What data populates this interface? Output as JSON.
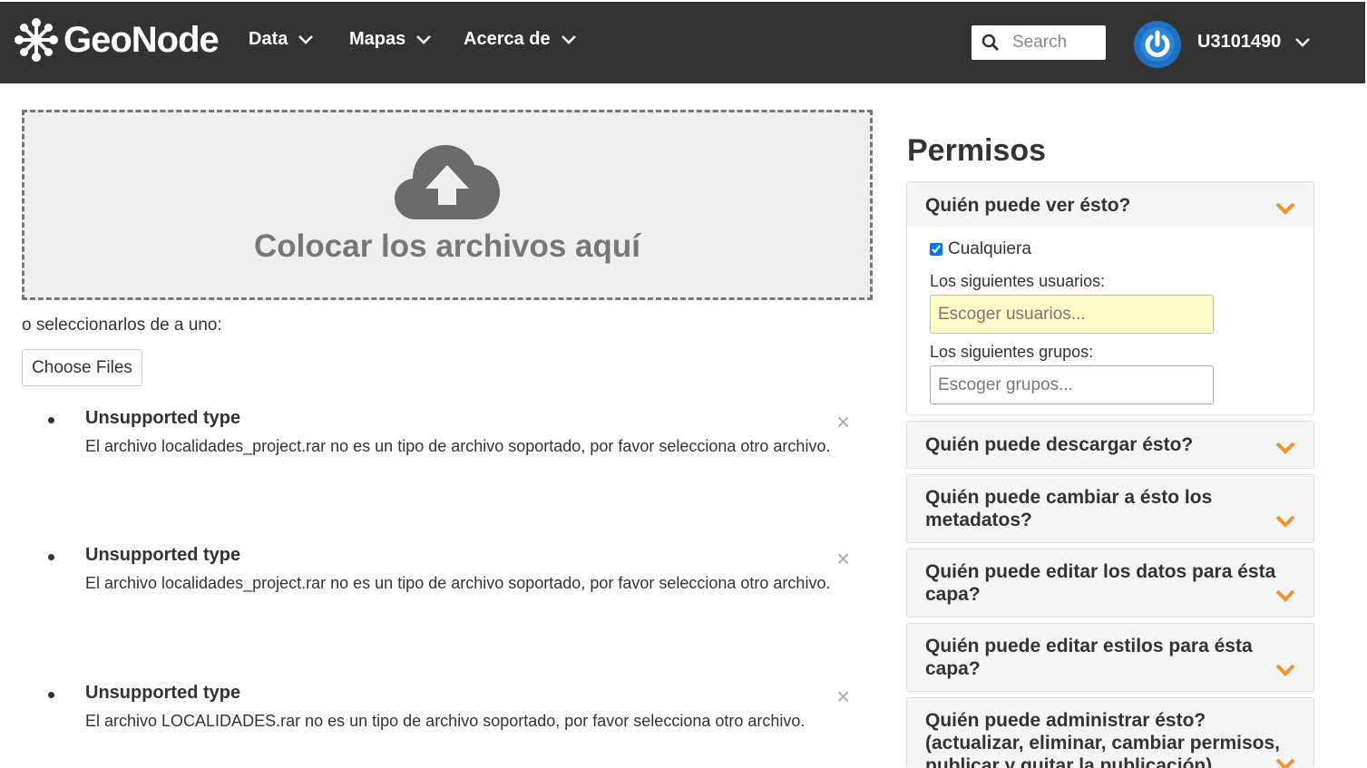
{
  "brand": {
    "name": "GeoNode"
  },
  "nav": {
    "items": [
      {
        "label": "Data"
      },
      {
        "label": "Mapas"
      },
      {
        "label": "Acerca de"
      }
    ],
    "search_placeholder": "Search",
    "username": "U3101490"
  },
  "upload": {
    "drop_text": "Colocar los archivos aquí",
    "select_hint": "o seleccionarlos de a uno:",
    "choose_label": "Choose Files",
    "errors": [
      {
        "title": "Unsupported type",
        "message": "El archivo localidades_project.rar no es un tipo de archivo soportado, por favor selecciona otro archivo.",
        "close": "×"
      },
      {
        "title": "Unsupported type",
        "message": "El archivo localidades_project.rar no es un tipo de archivo soportado, por favor selecciona otro archivo.",
        "close": "×"
      },
      {
        "title": "Unsupported type",
        "message": "El archivo LOCALIDADES.rar no es un tipo de archivo soportado, por favor selecciona otro archivo.",
        "close": "×"
      }
    ]
  },
  "permissions": {
    "title": "Permisos",
    "view": {
      "question": "Quién puede ver ésto?",
      "anyone_label": "Cualquiera",
      "anyone_checked": true,
      "users_label": "Los siguientes usuarios:",
      "users_placeholder": "Escoger usuarios...",
      "groups_label": "Los siguientes grupos:",
      "groups_placeholder": "Escoger grupos..."
    },
    "sections": [
      {
        "question": "Quién puede descargar ésto?"
      },
      {
        "question": "Quién puede cambiar a ésto los metadatos?"
      },
      {
        "question": "Quién puede editar los datos para ésta capa?"
      },
      {
        "question": "Quién puede editar estilos para ésta capa?"
      },
      {
        "question": "Quién puede administrar ésto? (actualizar, eliminar, cambiar permisos, publicar y quitar la publicación)"
      }
    ]
  },
  "colors": {
    "navbar": "#333333",
    "accent_chevron": "#f0932b",
    "highlight_field": "#fdfbc6"
  }
}
